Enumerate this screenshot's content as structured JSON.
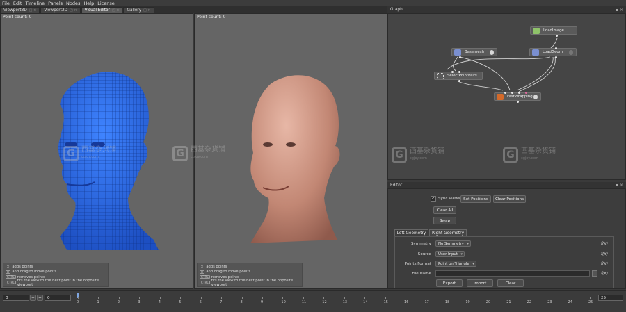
{
  "menu": [
    "File",
    "Edit",
    "Timeline",
    "Panels",
    "Nodes",
    "Help",
    "License"
  ],
  "tabs": [
    {
      "label": "Viewport3D",
      "active": false
    },
    {
      "label": "Viewport2D",
      "active": false
    },
    {
      "label": "Visual Editor",
      "active": true
    },
    {
      "label": "Gallery",
      "active": false
    }
  ],
  "viewport_left": {
    "label": "Point count: 0",
    "help": [
      {
        "key": "",
        "text": "adds points"
      },
      {
        "key": "",
        "text": "and drag to move points"
      },
      {
        "key": "CTRL",
        "text": "removes points"
      },
      {
        "key": "CTRL",
        "text": "fits the view to the next point in the opposite viewport"
      }
    ]
  },
  "viewport_right": {
    "label": "Point count: 0",
    "help": [
      {
        "key": "",
        "text": "adds points"
      },
      {
        "key": "",
        "text": "and drag to move points"
      },
      {
        "key": "CTRL",
        "text": "removes points"
      },
      {
        "key": "CTRL",
        "text": "fits the view to the next point in the opposite viewport"
      }
    ]
  },
  "watermark": {
    "mark": "G",
    "text": "西基杂货铺",
    "sub": "cgjoy.com"
  },
  "graph": {
    "title": "Graph",
    "nodes": {
      "loadimage": "LoadImage",
      "basemesh": "Basemesh",
      "loadgeom": "LoadGeom",
      "selectpointpairs": "SelectPointPairs",
      "fastwrapping": "FastWrapping"
    }
  },
  "editor": {
    "title": "Editor",
    "sync_views_label": "Sync Views",
    "sync_views_checked": true,
    "set_positions": "Set Positions",
    "clear_positions": "Clear Positions",
    "clear_all": "Clear All",
    "swap": "Swap",
    "tabs": [
      "Left Geometry",
      "Right Geometry"
    ],
    "fields": {
      "symmetry_label": "Symmetry",
      "symmetry_value": "No Symmetry",
      "source_label": "Source",
      "source_value": "User Input",
      "points_format_label": "Points Format",
      "points_format_value": "Point on Triangle",
      "file_name_label": "File Name",
      "file_name_value": ""
    },
    "fx": "f(x)",
    "export": "Export",
    "import": "Import",
    "clear": "Clear"
  },
  "timeline": {
    "start": "0",
    "current": "0",
    "end": "25",
    "ticks": [
      "0",
      "1",
      "2",
      "3",
      "4",
      "5",
      "6",
      "7",
      "8",
      "9",
      "10",
      "11",
      "12",
      "13",
      "14",
      "15",
      "16",
      "17",
      "18",
      "19",
      "20",
      "21",
      "22",
      "23",
      "24",
      "25"
    ],
    "minus": "−",
    "plus": "+"
  },
  "colors": {
    "mesh": "#2f6fe6",
    "skin": "#c9907e",
    "panel": "#656565"
  }
}
